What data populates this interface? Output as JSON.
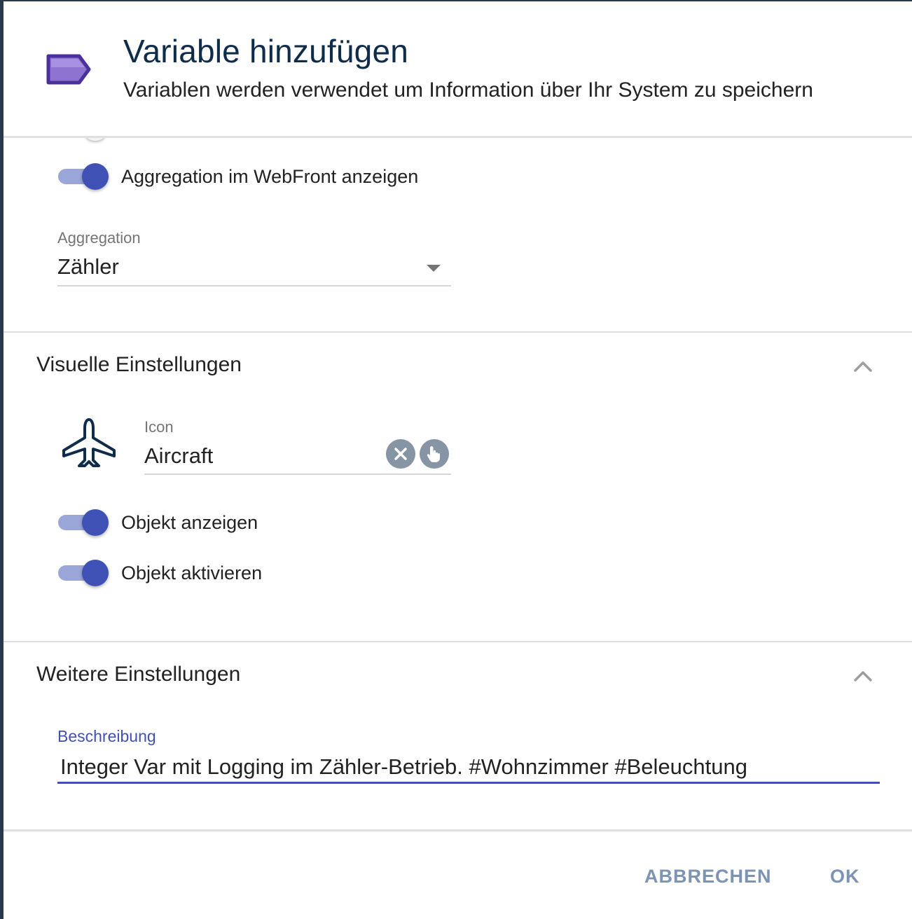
{
  "dialog": {
    "title": "Variable hinzufügen",
    "subtitle": "Variablen werden verwendet um Information über Ihr System zu speichern",
    "header_icon": "tag-icon",
    "accent_color": "#3f51b5",
    "title_color": "#0f2c4a"
  },
  "archive": {
    "aggregation_toggle_label": "Aggregation im WebFront anzeigen",
    "aggregation_toggle_on": true,
    "aggregation_label": "Aggregation",
    "aggregation_value": "Zähler"
  },
  "visual": {
    "section_title": "Visuelle Einstellungen",
    "icon_name": "airplane-icon",
    "icon_label": "Icon",
    "icon_value": "Aircraft",
    "clear_icon": "close-circle-icon",
    "pick_icon": "hand-pointer-icon",
    "show_object_label": "Objekt anzeigen",
    "show_object_on": true,
    "enable_object_label": "Objekt aktivieren",
    "enable_object_on": true
  },
  "more": {
    "section_title": "Weitere Einstellungen",
    "description_label": "Beschreibung",
    "description_value": "Integer Var mit Logging im Zähler-Betrieb. #Wohnzimmer #Beleuchtung"
  },
  "footer": {
    "cancel_label": "ABBRECHEN",
    "ok_label": "OK"
  }
}
